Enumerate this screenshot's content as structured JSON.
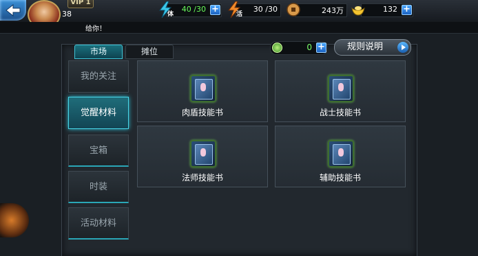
{
  "header": {
    "vip": "VIP 1",
    "level": "38",
    "stamina": {
      "label": "体",
      "value": "40 /30"
    },
    "activity": {
      "label": "活",
      "value": "30 /30"
    },
    "copper": {
      "value": "243万"
    },
    "gold": {
      "value": "132"
    }
  },
  "marquee": {
    "text": "给你！"
  },
  "tabs": [
    {
      "label": "市场",
      "active": true
    },
    {
      "label": "摊位",
      "active": false
    }
  ],
  "currency": {
    "value": "0"
  },
  "rules_button": {
    "label": "规则说明"
  },
  "sidebar": {
    "items": [
      {
        "label": "我的关注",
        "active": false
      },
      {
        "label": "觉醒材料",
        "active": true
      },
      {
        "label": "宝箱",
        "active": false
      },
      {
        "label": "时装",
        "active": false
      },
      {
        "label": "活动材料",
        "active": false
      }
    ]
  },
  "cards": [
    {
      "label": "肉盾技能书",
      "icon": "skill-book-icon"
    },
    {
      "label": "战士技能书",
      "icon": "skill-book-icon"
    },
    {
      "label": "法师技能书",
      "icon": "skill-book-icon"
    },
    {
      "label": "辅助技能书",
      "icon": "skill-book-icon"
    }
  ],
  "colors": {
    "accent": "#3fc4d6",
    "plus_button": "#1d63c2",
    "currency_text": "#7bff6a"
  }
}
